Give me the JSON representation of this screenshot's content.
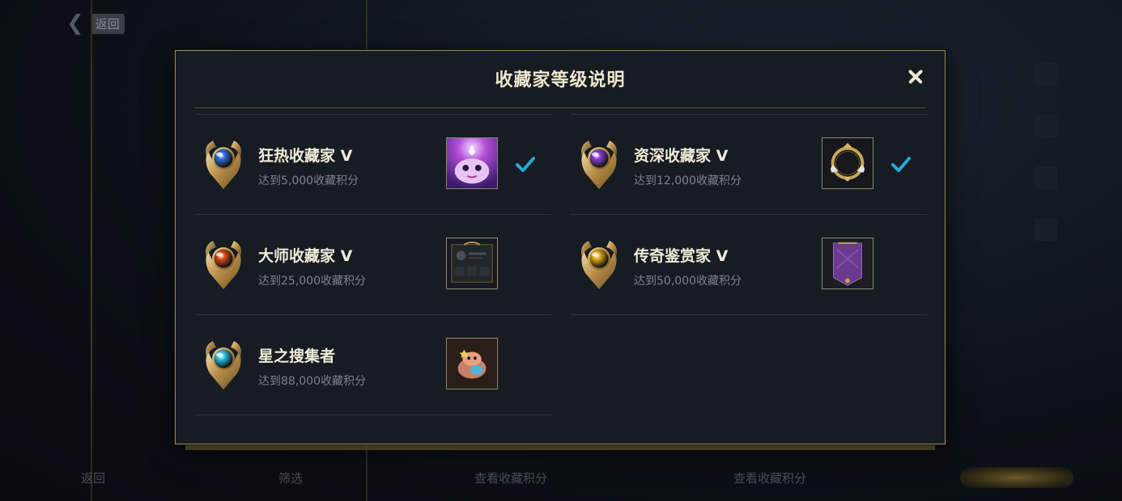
{
  "background": {
    "back_label": "返回",
    "bottom_labels": [
      "返回",
      "筛选",
      "查看收藏积分",
      "查看收藏积分"
    ]
  },
  "modal": {
    "title": "收藏家等级说明",
    "levels": [
      {
        "name": "狂热收藏家 V",
        "requirement": "达到5,000收藏积分",
        "gem_color": "#2f6fd6",
        "achieved": true,
        "reward_icon": "poro-icon"
      },
      {
        "name": "资深收藏家 V",
        "requirement": "达到12,000收藏积分",
        "gem_color": "#8a3fd6",
        "achieved": true,
        "reward_icon": "ring-frame-icon"
      },
      {
        "name": "大师收藏家 V",
        "requirement": "达到25,000收藏积分",
        "gem_color": "#d94a1a",
        "achieved": false,
        "reward_icon": "profile-card-icon"
      },
      {
        "name": "传奇鉴赏家 V",
        "requirement": "达到50,000收藏积分",
        "gem_color": "#e0a817",
        "achieved": false,
        "reward_icon": "banner-icon"
      },
      {
        "name": "星之搜集者",
        "requirement": "达到88,000收藏积分",
        "gem_color": "#2ec3e6",
        "achieved": false,
        "reward_icon": "star-poro-icon"
      }
    ],
    "colors": {
      "border": "#a08a56",
      "check": "#2aa8d8"
    }
  }
}
